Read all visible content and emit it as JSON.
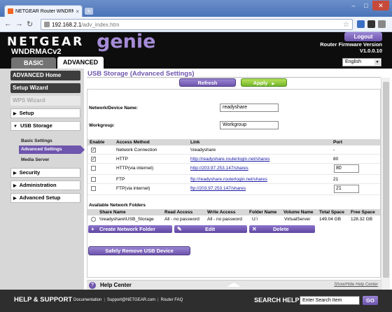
{
  "browser": {
    "tab_title": "NETGEAR Router WNDRM...",
    "tab_close": "×",
    "new_tab": "+",
    "url_host": "192.168.2.1",
    "url_path": "/adv_index.htm",
    "window_controls": [
      "–",
      "□",
      "✕"
    ]
  },
  "header": {
    "brand": "NETGEAR",
    "product": "genie",
    "model": "WNDRMACv2",
    "logout_label": "Logout",
    "firmware_label": "Router Firmware Version",
    "firmware_version": "V1.0.0.10",
    "tabs": [
      {
        "label": "BASIC"
      },
      {
        "label": "ADVANCED"
      }
    ],
    "language": "English"
  },
  "sidebar": {
    "advanced_home": "ADVANCED Home",
    "setup_wizard": "Setup Wizard",
    "wps_wizard": "WPS Wizard",
    "sections": [
      {
        "label": "Setup",
        "arrow": "▶"
      },
      {
        "label": "USB Storage",
        "arrow": "▼"
      },
      {
        "label": "Security",
        "arrow": "▶"
      },
      {
        "label": "Administration",
        "arrow": "▶"
      },
      {
        "label": "Advanced Setup",
        "arrow": "▶"
      }
    ],
    "usb_items": [
      {
        "label": "Basic Settings"
      },
      {
        "label": "Advanced Settings"
      },
      {
        "label": "Media Server"
      }
    ]
  },
  "main": {
    "title": "USB Storage (Advanced Settings)",
    "refresh_label": "Refresh",
    "apply_label": "Apply",
    "apply_arrow": "▶",
    "device_name_label": "Network/Device Name:",
    "device_name_value": "readyshare",
    "workgroup_label": "Workgroup:",
    "workgroup_value": "Workgroup",
    "access_headers": [
      "Enable",
      "Access Method",
      "Link",
      "Port"
    ],
    "access_rows": [
      {
        "checked": "✓",
        "method": "Network Connection",
        "link": "\\\\readyshare",
        "port": "-"
      },
      {
        "checked": "✓",
        "method": "HTTP",
        "link": "http://readyshare.routerlogin.net/shares",
        "port": "80"
      },
      {
        "checked": "",
        "method": "HTTP(via internet)",
        "link": "http://203.97.253.147/shares",
        "port": "80"
      },
      {
        "checked": "",
        "method": "FTP",
        "link": "ftp://readyshare.routerlogin.net/shares",
        "port": "21"
      },
      {
        "checked": "",
        "method": "FTP(via internet)",
        "link": "ftp://203.97.253.147/shares",
        "port": "21"
      }
    ],
    "folders_title": "Available Network Folders",
    "folder_headers": [
      "Share Name",
      "Read Access",
      "Write Access",
      "Folder Name",
      "Volume Name",
      "Total Space",
      "Free Space"
    ],
    "folder_rows": [
      {
        "share": "\\\\readyshare\\USB_Storage",
        "read": "All - no password",
        "write": "All - no password",
        "folder": "U:\\",
        "volume": "VirtualServer",
        "total": "149.04 GB",
        "free": "128.32 GB"
      }
    ],
    "create_label": "Create Network Folder",
    "edit_label": "Edit",
    "delete_label": "Delete",
    "safe_remove_label": "Safely Remove USB Device"
  },
  "help": {
    "icon": "?",
    "title": "Help Center",
    "toggle": "Show/Hide Help Center"
  },
  "footer": {
    "title": "HELP & SUPPORT",
    "links": [
      "Documentation",
      "Support@NETGEAR.com",
      "Router FAQ"
    ],
    "search_label": "SEARCH HELP",
    "search_placeholder": "Enter Search Item",
    "go_label": "GO"
  }
}
